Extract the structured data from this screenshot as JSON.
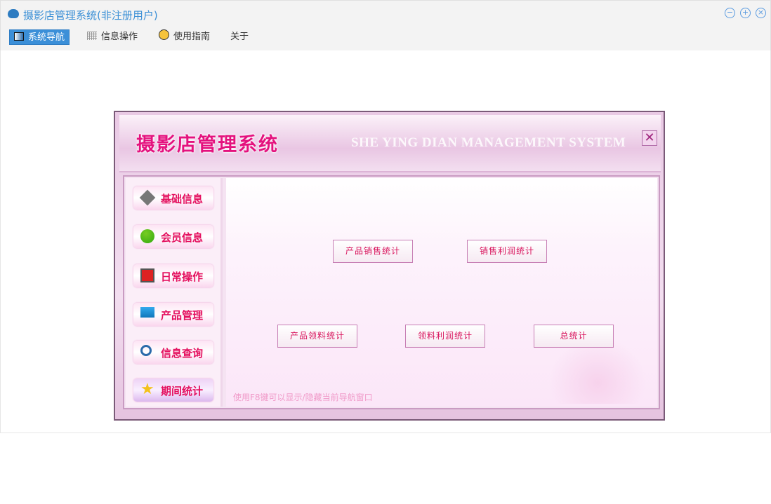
{
  "window": {
    "title": "摄影店管理系统(非注册用户)",
    "controls": [
      "minimize",
      "restore",
      "close"
    ]
  },
  "menu": [
    {
      "label": "系统导航",
      "icon": "monitor-icon",
      "active": true
    },
    {
      "label": "信息操作",
      "icon": "grid-icon"
    },
    {
      "label": "使用指南",
      "icon": "help-icon"
    },
    {
      "label": "关于"
    }
  ],
  "dialog": {
    "title": "摄影店管理系统",
    "subtitle": "SHE YING DIAN MANAGEMENT SYSTEM",
    "sidebar": [
      {
        "label": "基础信息",
        "icon": "tools-icon"
      },
      {
        "label": "会员信息",
        "icon": "users-icon"
      },
      {
        "label": "日常操作",
        "icon": "alert-icon"
      },
      {
        "label": "产品管理",
        "icon": "computer-icon"
      },
      {
        "label": "信息查询",
        "icon": "search-icon"
      },
      {
        "label": "期间统计",
        "icon": "star-icon",
        "active": true
      }
    ],
    "buttons": [
      "产品销售统计",
      "销售利润统计",
      "产品领料统计",
      "领料利润统计",
      "总统计"
    ],
    "hint": "使用F8键可以显示/隐藏当前导航窗口"
  },
  "colors": {
    "accent": "#3b8fd8",
    "pink": "#e4127e"
  }
}
